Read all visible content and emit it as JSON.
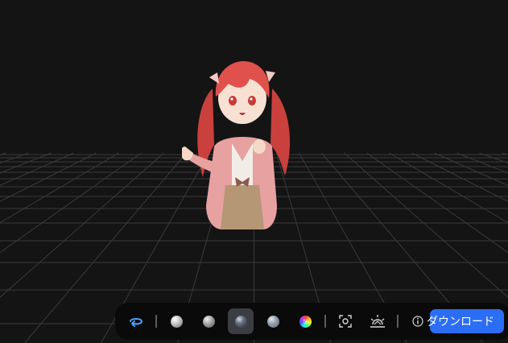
{
  "viewer": {
    "background": "#141414",
    "grid_color": "#3a3a3a"
  },
  "model": {
    "name_icon": "anime-girl-3d-model",
    "hair_color": "#e0504c",
    "cardigan_color": "#e9a3a3"
  },
  "toolbar": {
    "items": [
      {
        "icon": "rotate-icon",
        "active": false
      },
      {
        "icon": "white-material-sphere-icon",
        "active": false
      },
      {
        "icon": "gray-material-sphere-icon",
        "active": false
      },
      {
        "icon": "dark-glossy-material-sphere-icon",
        "active": true
      },
      {
        "icon": "matcap-sphere-icon",
        "active": false
      },
      {
        "icon": "normal-color-sphere-icon",
        "active": false
      },
      {
        "icon": "focus-frame-icon",
        "active": false
      },
      {
        "icon": "lighting-icon",
        "active": false
      },
      {
        "icon": "info-icon",
        "active": false
      }
    ],
    "download_label": "ダウンロード",
    "accent": "#2b6ef5"
  }
}
